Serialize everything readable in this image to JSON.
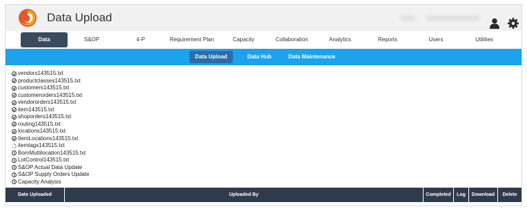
{
  "header": {
    "title": "Data Upload",
    "icons": {
      "logo": "swirl-logo",
      "user": "user-icon",
      "settings": "gear-icon"
    },
    "colors": {
      "background": "#f1f1f1",
      "logo_primary": "#e8562a",
      "logo_secondary": "#f5a623"
    }
  },
  "main_nav": {
    "active": "Data",
    "items": [
      {
        "label": "Data"
      },
      {
        "label": "S&OP"
      },
      {
        "label": "4-P"
      },
      {
        "label": "Requirement Plan"
      },
      {
        "label": "Capacity"
      },
      {
        "label": "Collaboration"
      },
      {
        "label": "Analytics"
      },
      {
        "label": "Reports"
      },
      {
        "label": "Users"
      },
      {
        "label": "Utilities"
      }
    ],
    "colors": {
      "active_bg": "#3a4a5e"
    }
  },
  "sub_nav": {
    "active": "Data Upload",
    "items": [
      {
        "label": "Data Upload"
      },
      {
        "label": "Data Hub"
      },
      {
        "label": "Data Maintenance"
      }
    ],
    "colors": {
      "bar": "#1ca3ec",
      "active_bg": "#2c6ca8"
    }
  },
  "files": [
    {
      "name": "vendors143515.txt",
      "status": "done"
    },
    {
      "name": "productclasses143515.txt",
      "status": "done"
    },
    {
      "name": "customers143515.txt",
      "status": "done"
    },
    {
      "name": "customerorders143515.txt",
      "status": "done"
    },
    {
      "name": "vendororders143515.txt",
      "status": "done"
    },
    {
      "name": "item143515.txt",
      "status": "done"
    },
    {
      "name": "shoporders143515.txt",
      "status": "done"
    },
    {
      "name": "routing143515.txt",
      "status": "done"
    },
    {
      "name": "locations143515.txt",
      "status": "done"
    },
    {
      "name": "ItemLocations143515.txt",
      "status": "done"
    },
    {
      "name": "itemtags143515.txt",
      "status": "loading"
    },
    {
      "name": "BomMultilocation143515.txt",
      "status": "pending"
    },
    {
      "name": "LotControl143515.txt",
      "status": "pending"
    },
    {
      "name": "S&OP Actual Data Update",
      "status": "pending"
    },
    {
      "name": "S&OP Supply Orders Update",
      "status": "pending"
    },
    {
      "name": "Capacity Analysis",
      "status": "pending"
    }
  ],
  "table": {
    "columns": [
      {
        "label": "Date Uploaded"
      },
      {
        "label": "Uploaded By"
      },
      {
        "label": "Completed"
      },
      {
        "label": "Log"
      },
      {
        "label": "Download"
      },
      {
        "label": "Delete"
      }
    ],
    "colors": {
      "header_bg": "#2f3b4c"
    }
  }
}
